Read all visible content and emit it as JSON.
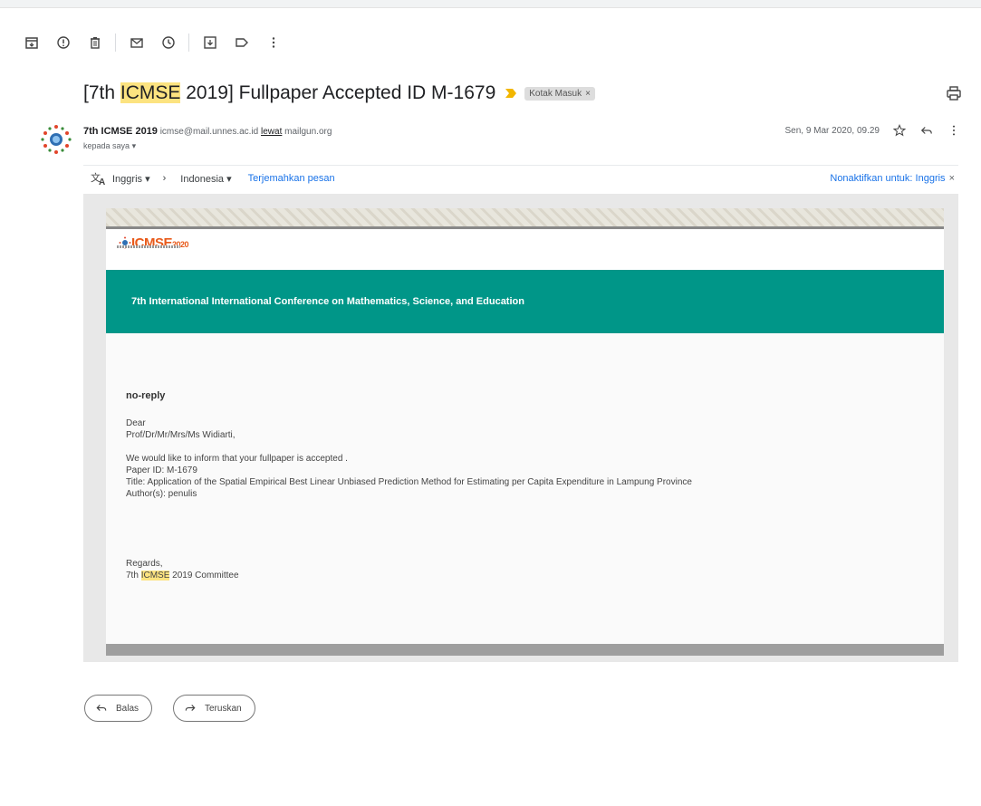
{
  "toolbar": {
    "icons": [
      "archive-icon",
      "report-spam-icon",
      "delete-icon",
      "mark-unread-icon",
      "snooze-icon",
      "move-to-icon",
      "label-icon",
      "more-icon"
    ]
  },
  "subject": {
    "prefix": "[7th ",
    "highlight": "ICMSE",
    "suffix": " 2019] Fullpaper Accepted ID M-1679",
    "label_chip": "Kotak Masuk",
    "label_chip_close": "×"
  },
  "sender": {
    "name": "7th ICMSE 2019",
    "email": "icmse@mail.unnes.ac.id",
    "via_label": "lewat",
    "via_domain": "mailgun.org",
    "to": "kepada saya",
    "date": "Sen, 9 Mar 2020, 09.29"
  },
  "translate": {
    "from_lang": "Inggris",
    "to_lang": "Indonesia",
    "translate_link": "Terjemahkan pesan",
    "disable_link": "Nonaktifkan untuk: Inggris",
    "close": "×"
  },
  "email": {
    "logo_text": "ICMSE",
    "logo_year": "2020",
    "banner": "7th International International Conference on Mathematics, Science, and Education",
    "from": "no-reply",
    "greeting": "Dear",
    "recipient": "Prof/Dr/Mr/Mrs/Ms Widiarti,",
    "line1": "We would like to inform that your fullpaper is accepted .",
    "paper_id": "Paper ID: M-1679",
    "title": "Title: Application of the Spatial Empirical Best Linear Unbiased Prediction Method for Estimating per Capita Expenditure in Lampung Province",
    "authors": "Author(s): penulis",
    "regards": "Regards,",
    "sig_prefix": "7th ",
    "sig_highlight": "ICMSE",
    "sig_suffix": " 2019 Committee"
  },
  "actions": {
    "reply": "Balas",
    "forward": "Teruskan"
  },
  "colors": {
    "highlight": "#fce380",
    "banner": "#009688",
    "link": "#1a73e8",
    "logo": "#e85a1a"
  }
}
